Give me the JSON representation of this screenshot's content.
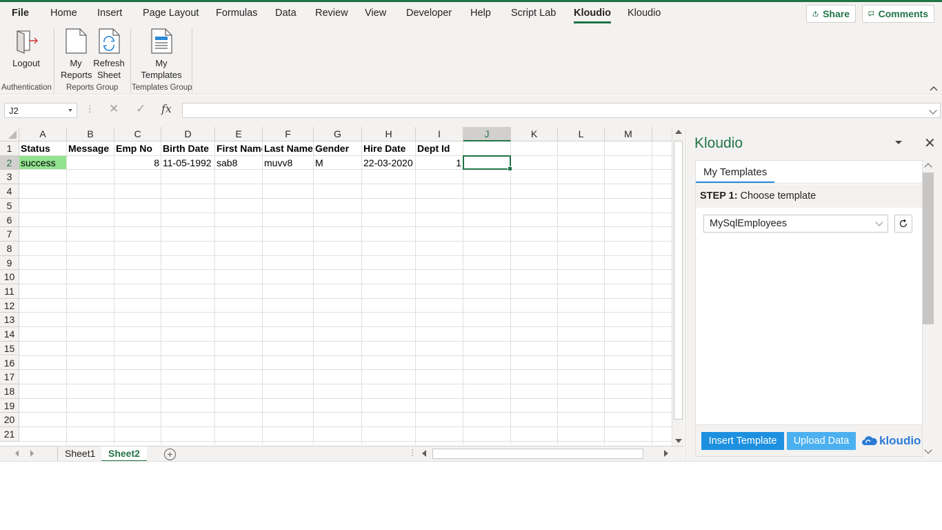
{
  "ribbon": {
    "tabs": [
      "File",
      "Home",
      "Insert",
      "Page Layout",
      "Formulas",
      "Data",
      "Review",
      "View",
      "Developer",
      "Help",
      "Script Lab",
      "Kloudio",
      "Kloudio"
    ],
    "active_tab": "Kloudio",
    "share_label": "Share",
    "comments_label": "Comments",
    "buttons": {
      "logout": "Logout",
      "my_reports_1": "My",
      "my_reports_2": "Reports",
      "refresh_1": "Refresh",
      "refresh_2": "Sheet",
      "my_templates_1": "My",
      "my_templates_2": "Templates"
    },
    "groups": {
      "authentication": "Authentication",
      "reports": "Reports Group",
      "templates": "Templates Group"
    }
  },
  "formula_bar": {
    "name_box": "J2",
    "cancel_icon": "✕",
    "enter_icon": "✓",
    "fx_label": "fx",
    "value": ""
  },
  "sheet": {
    "columns": [
      "A",
      "B",
      "C",
      "D",
      "E",
      "F",
      "G",
      "H",
      "I",
      "J",
      "K",
      "L",
      "M"
    ],
    "selected_column": "J",
    "rows": [
      "1",
      "2",
      "3",
      "4",
      "5",
      "6",
      "7",
      "8",
      "9",
      "10",
      "11",
      "12",
      "13",
      "14",
      "15",
      "16",
      "17",
      "18",
      "19",
      "20",
      "21"
    ],
    "selected_row": "2",
    "headers": [
      "Status",
      "Message",
      "Emp No",
      "Birth Date",
      "First Name",
      "Last Name",
      "Gender",
      "Hire Date",
      "Dept Id"
    ],
    "row2": [
      "success",
      "",
      "8",
      "11-05-1992",
      "sab8",
      "muvv8",
      "M",
      "22-03-2020",
      "1"
    ],
    "status_color": "#92e38f"
  },
  "sheet_tabs": {
    "tabs": [
      "Sheet1",
      "Sheet2"
    ],
    "active": "Sheet2",
    "add_label": "+"
  },
  "pane": {
    "title": "Kloudio",
    "tab_label": "My Templates",
    "step_bold": "STEP 1:",
    "step_text": " Choose template",
    "selected_template": "MySqlEmployees",
    "insert_button": "Insert Template",
    "upload_button": "Upload Data",
    "logo_text": "kloudio"
  },
  "colors": {
    "excel_green": "#217346",
    "pane_blue": "#1e90e0",
    "upload_blue": "#4bb0ef",
    "logo_blue": "#2b7bd6"
  }
}
